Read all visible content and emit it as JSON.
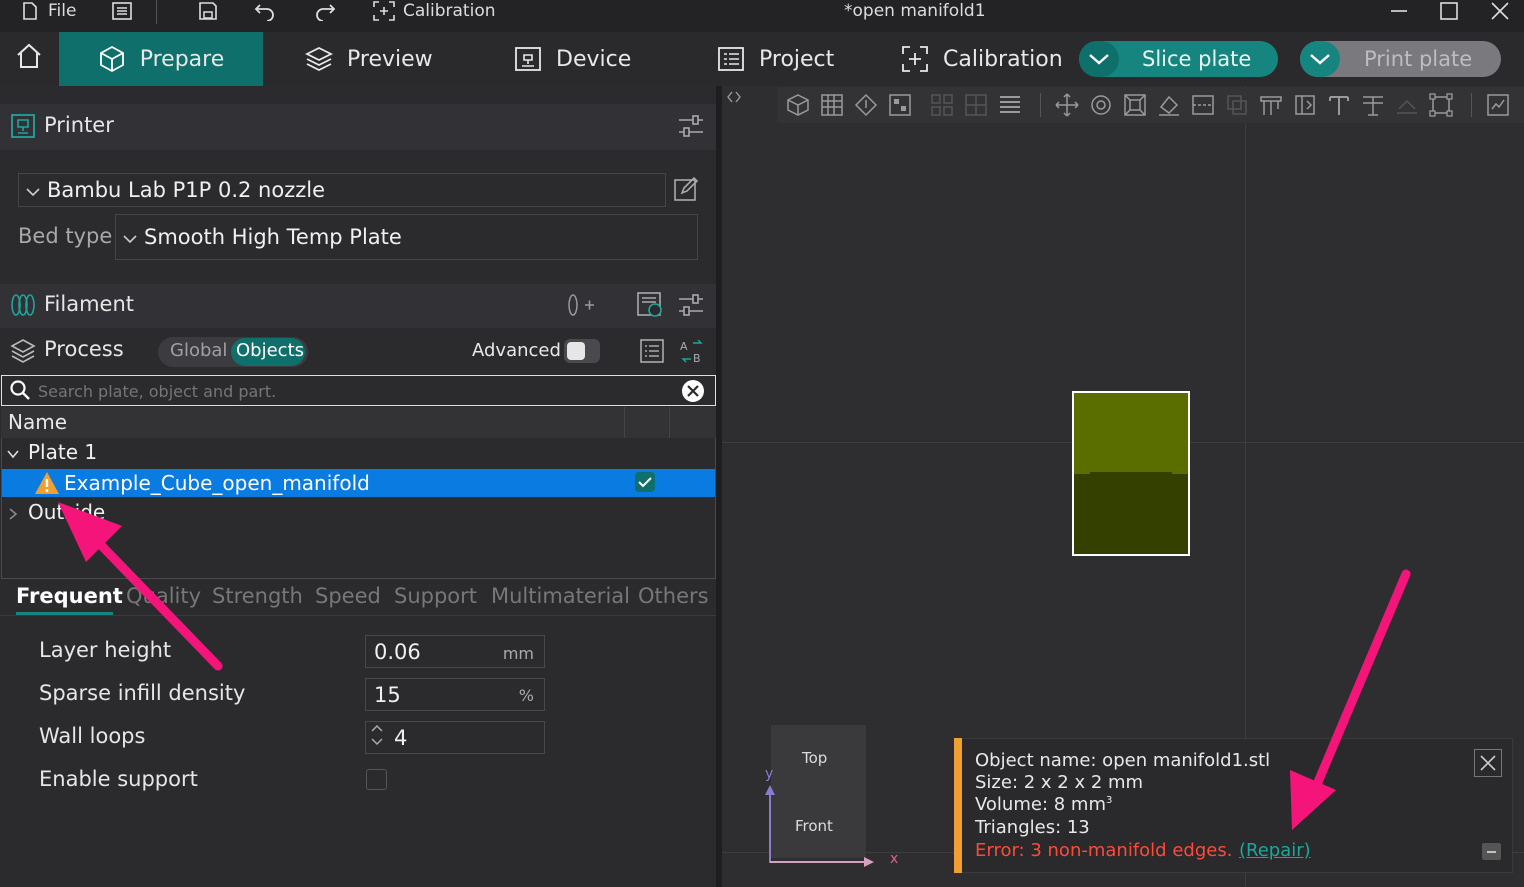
{
  "titlebar": {
    "file_label": "File",
    "calibration_label": "Calibration",
    "document_title": "*open manifold1"
  },
  "tabs": {
    "prepare": "Prepare",
    "preview": "Preview",
    "device": "Device",
    "project": "Project",
    "calibration": "Calibration"
  },
  "actions": {
    "slice_plate": "Slice plate",
    "print_plate": "Print plate"
  },
  "printer": {
    "section_title": "Printer",
    "selected_printer": "Bambu Lab P1P 0.2 nozzle",
    "bed_type_label": "Bed type",
    "bed_type_value": "Smooth High Temp Plate"
  },
  "filament": {
    "section_title": "Filament"
  },
  "process": {
    "section_title": "Process",
    "toggle_global": "Global",
    "toggle_objects": "Objects",
    "advanced_label": "Advanced",
    "advanced_enabled": false
  },
  "object_list": {
    "search_placeholder": "Search plate, object and part.",
    "column_name": "Name",
    "plate": "Plate 1",
    "object": "Example_Cube_open_manifold",
    "outside": "Outside"
  },
  "settings_tabs": [
    "Frequent",
    "Quality",
    "Strength",
    "Speed",
    "Support",
    "Multimaterial",
    "Others"
  ],
  "settings": {
    "layer_height_label": "Layer height",
    "layer_height_value": "0.06",
    "layer_height_unit": "mm",
    "infill_label": "Sparse infill density",
    "infill_value": "15",
    "infill_unit": "%",
    "wall_loops_label": "Wall loops",
    "wall_loops_value": "4",
    "support_label": "Enable support"
  },
  "navcube": {
    "top": "Top",
    "front": "Front",
    "axis_x": "x",
    "axis_y": "y"
  },
  "info_panel": {
    "object_name": "Object name: open manifold1.stl",
    "size": "Size: 2 x 2 x 2 mm",
    "volume": "Volume: 8 mm",
    "volume_sup": "3",
    "triangles": "Triangles: 13",
    "error": "Error: 3 non-manifold edges.",
    "repair": "(Repair)"
  },
  "colors": {
    "accent": "#0e6f6b",
    "accent_light": "#17857f",
    "selection": "#0a7be0",
    "annotation_arrow": "#f5157a",
    "error_text": "#ff4a3a",
    "info_bar": "#f0a030",
    "cube_top": "#5a6e00",
    "cube_bottom": "#344000"
  }
}
